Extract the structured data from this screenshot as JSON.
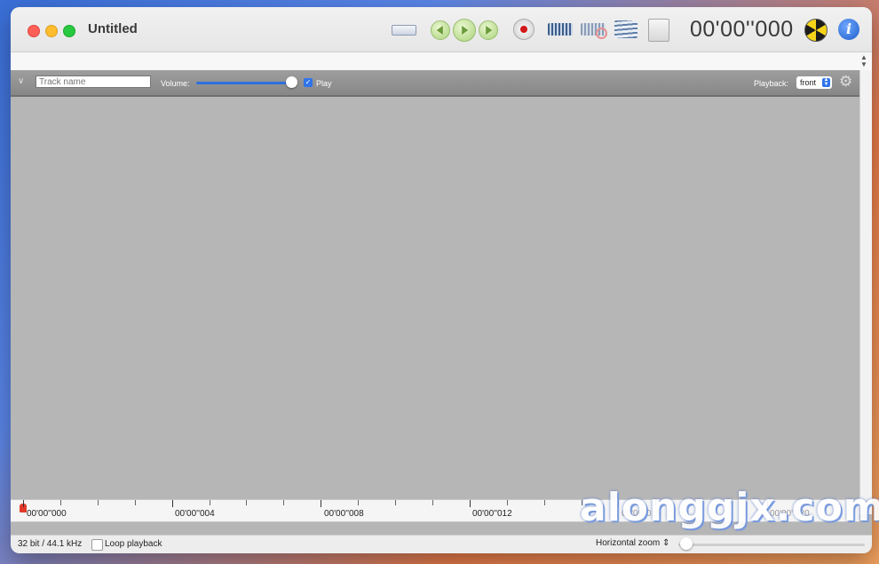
{
  "window": {
    "title": "Untitled"
  },
  "toolbar": {
    "timer": "00'00''000",
    "icons": [
      "ruler-icon",
      "rewind-icon",
      "play-icon",
      "fast-forward-icon",
      "record-icon",
      "waveform-icon",
      "waveform-disabled-icon",
      "lines-icon",
      "document-icon",
      "radiation-icon",
      "info-icon"
    ],
    "info_glyph": "i"
  },
  "track": {
    "name_placeholder": "Track name",
    "volume_label": "Volume:",
    "volume_level": 0.95,
    "play_checked": true,
    "play_label": "Play",
    "playback_label": "Playback:",
    "playback_value": "front",
    "checkmark": "✓"
  },
  "timeline": {
    "labels": [
      "00'00''000",
      "00'00''004",
      "00'00''008",
      "00'00''012",
      "00'00''016",
      "00'00''020"
    ]
  },
  "status": {
    "bitrate": "32 bit / 44.1 kHz",
    "loop_label": "Loop playback",
    "loop_checked": false,
    "zoom_label": "Horizontal zoom ⇕",
    "zoom_level": 0.0
  },
  "watermark": {
    "text": "alonggjx.com"
  },
  "colors": {
    "accent": "#2f74ea",
    "record": "#d01818",
    "background": "#b6b6b6"
  }
}
